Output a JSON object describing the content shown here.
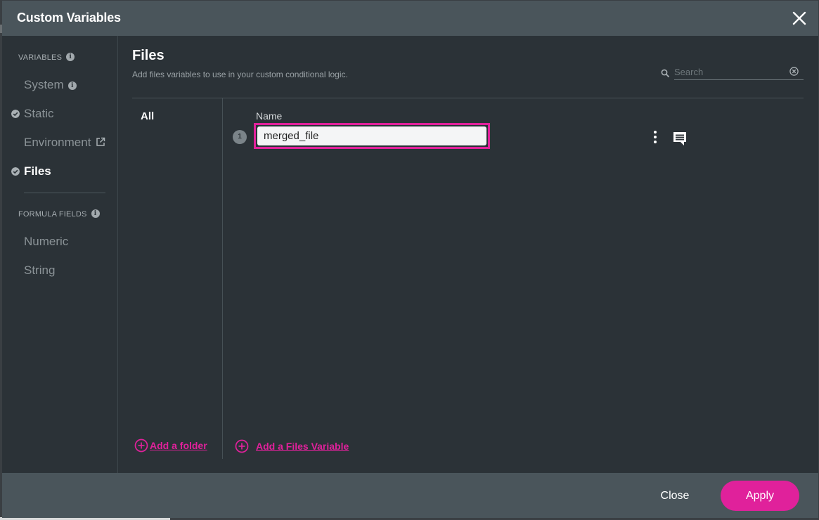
{
  "dialog": {
    "title": "Custom Variables"
  },
  "sidebar": {
    "variables_label": "VARIABLES",
    "variables_info": "i",
    "items": [
      {
        "label": "System",
        "info": "i"
      },
      {
        "label": "Static"
      },
      {
        "label": "Environment"
      },
      {
        "label": "Files"
      }
    ],
    "formula_label": "FORMULA FIELDS",
    "formula_info": "i",
    "formula_items": [
      {
        "label": "Numeric"
      },
      {
        "label": "String"
      }
    ]
  },
  "main": {
    "title": "Files",
    "subtitle": "Add files variables to use in your custom conditional logic.",
    "search": {
      "placeholder": "Search"
    },
    "folders": {
      "all_label": "All"
    },
    "table": {
      "name_header": "Name",
      "rows": [
        {
          "index": "1",
          "name": "merged_file"
        }
      ]
    },
    "add_folder_label": "Add a folder",
    "add_variable_label": "Add a Files Variable"
  },
  "footer": {
    "close_label": "Close",
    "apply_label": "Apply"
  },
  "colors": {
    "accent": "#e0219b",
    "header_bg": "#4a555b",
    "panel_bg": "#2b3237"
  },
  "icons": {
    "close": "close-icon",
    "search": "search-icon",
    "clear": "clear-circle-icon",
    "external": "external-link-icon",
    "check": "check-circle-icon",
    "kebab": "kebab-menu-icon",
    "comment": "comment-icon",
    "add": "add-circle-icon"
  }
}
